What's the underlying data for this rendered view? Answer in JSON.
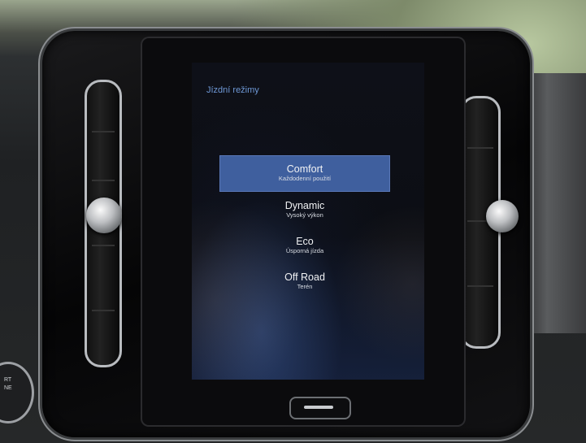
{
  "screen": {
    "title": "Jízdní režimy"
  },
  "modes": [
    {
      "label": "Comfort",
      "sub": "Každodenní použití",
      "selected": true
    },
    {
      "label": "Dynamic",
      "sub": "Vysoký výkon",
      "selected": false
    },
    {
      "label": "Eco",
      "sub": "Úsporná jízda",
      "selected": false
    },
    {
      "label": "Off Road",
      "sub": "Terén",
      "selected": false
    }
  ],
  "start_button": {
    "line1": "RT",
    "line2": "NE"
  },
  "colors": {
    "accent": "#3f5f9e",
    "title_text": "#6f99d6"
  }
}
